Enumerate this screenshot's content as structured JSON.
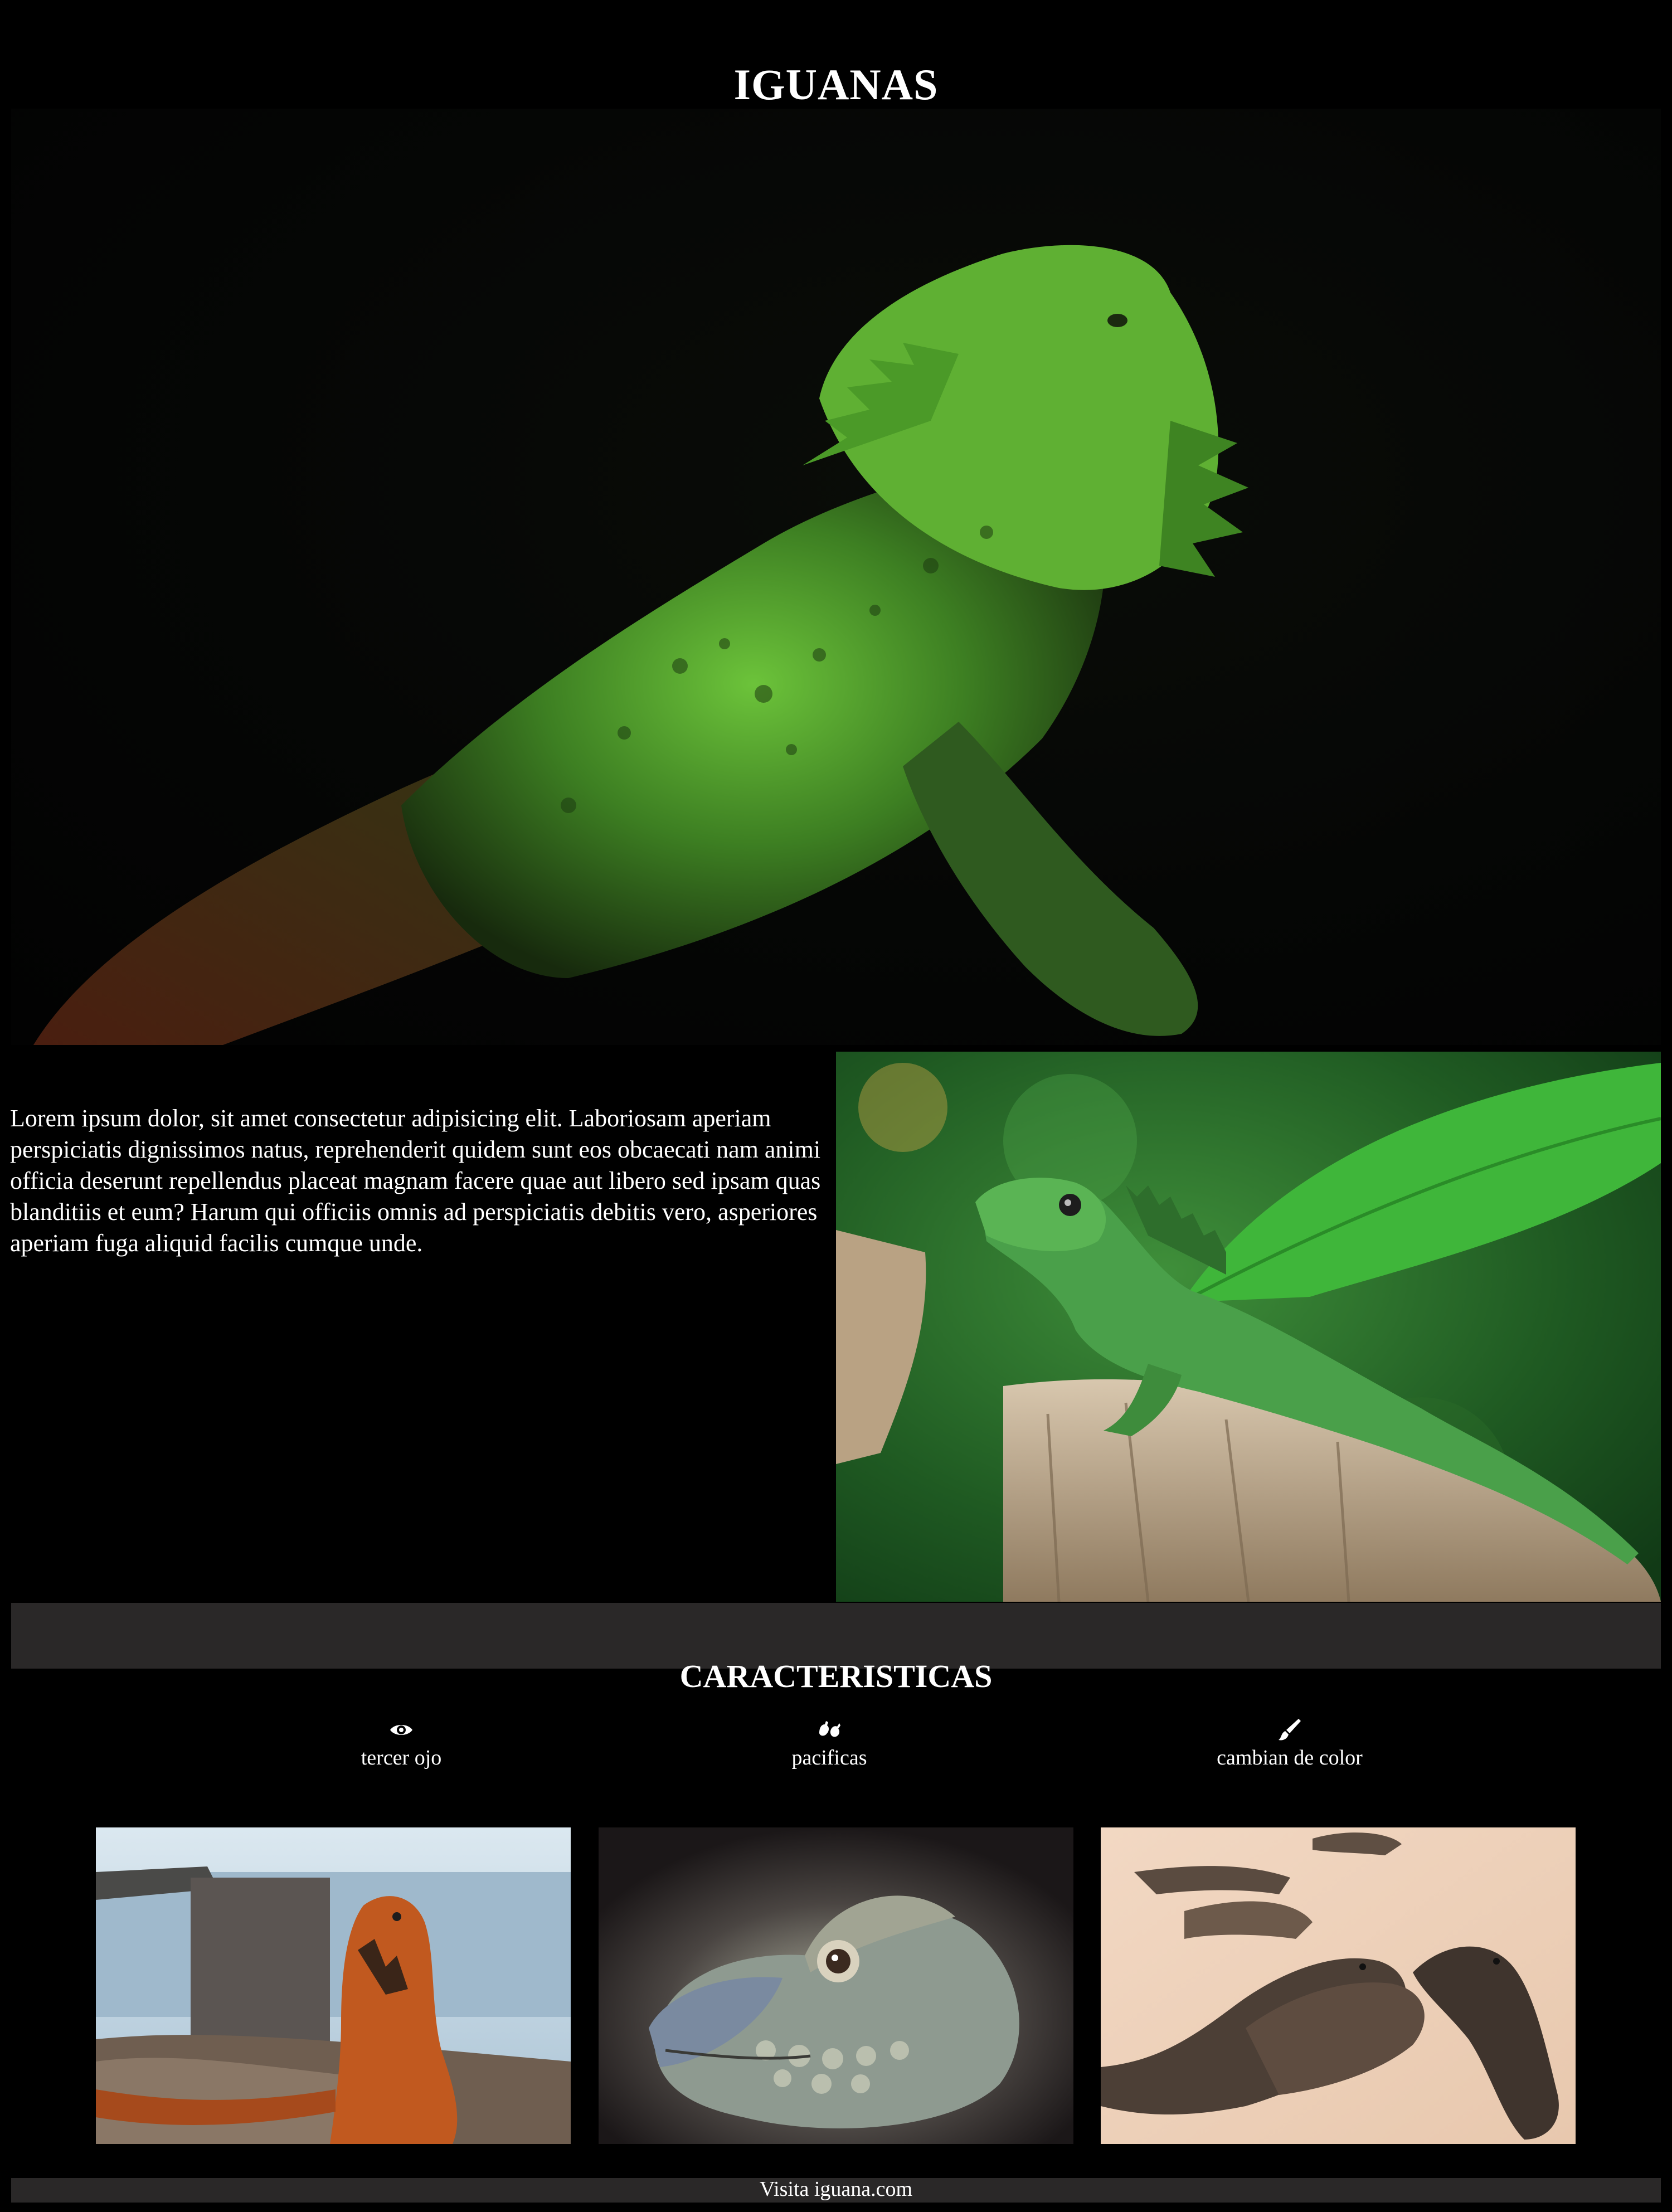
{
  "page": {
    "title": "IGUANAS"
  },
  "intro": {
    "text": "Lorem ipsum dolor, sit amet consectetur adipisicing elit. Laboriosam aperiam perspiciatis dignissimos natus, reprehenderit quidem sunt eos obcaecati nam animi officia deserunt repellendus placeat magnam facere quae aut libero sed ipsam quas blanditiis et eum? Harum qui officiis omnis ad perspiciatis debitis vero, asperiores aperiam fuga aliquid facilis cumque unde."
  },
  "features": {
    "title": "CARACTERISTICAS",
    "items": [
      {
        "label": "tercer ojo",
        "icon": "eye-icon"
      },
      {
        "label": "pacificas",
        "icon": "peace-hands-icon"
      },
      {
        "label": "cambian de color",
        "icon": "paintbrush-icon"
      }
    ]
  },
  "footer": {
    "text": "Visita iguana.com"
  },
  "colors": {
    "background": "#000000",
    "band": "#2a2828",
    "text": "#ffffff"
  }
}
